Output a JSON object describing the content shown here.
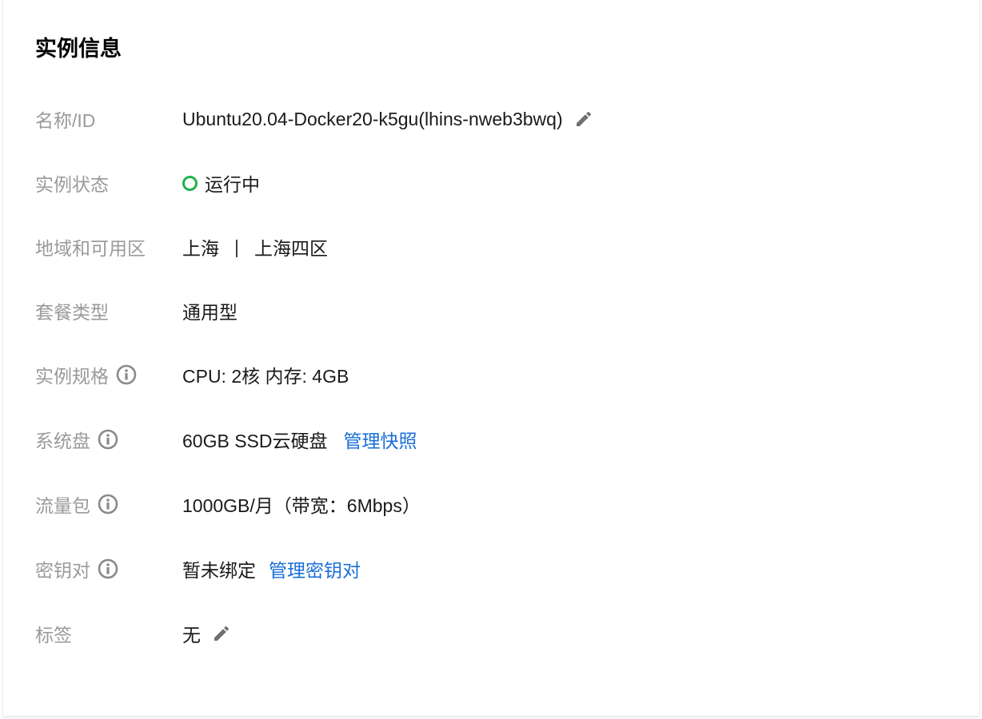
{
  "card": {
    "title": "实例信息"
  },
  "rows": {
    "name": {
      "label": "名称/ID",
      "value": "Ubuntu20.04-Docker20-k5gu(lhins-nweb3bwq)",
      "edit_icon": "pencil-icon"
    },
    "status": {
      "label": "实例状态",
      "value": "运行中",
      "status_color": "#20b24a"
    },
    "region": {
      "label": "地域和可用区",
      "region": "上海",
      "separator": "|",
      "zone": "上海四区"
    },
    "package": {
      "label": "套餐类型",
      "value": "通用型"
    },
    "spec": {
      "label": "实例规格",
      "value": "CPU: 2核 内存: 4GB",
      "info_icon": "info-icon"
    },
    "disk": {
      "label": "系统盘",
      "value": "60GB SSD云硬盘",
      "link": "管理快照",
      "info_icon": "info-icon"
    },
    "traffic": {
      "label": "流量包",
      "value": "1000GB/月（带宽：6Mbps）",
      "info_icon": "info-icon"
    },
    "keypair": {
      "label": "密钥对",
      "value": "暂未绑定",
      "link": "管理密钥对",
      "info_icon": "info-icon"
    },
    "tags": {
      "label": "标签",
      "value": "无",
      "edit_icon": "pencil-icon"
    }
  },
  "colors": {
    "link": "#1a6fd8",
    "label": "#9a9a9a",
    "running": "#20b24a"
  }
}
